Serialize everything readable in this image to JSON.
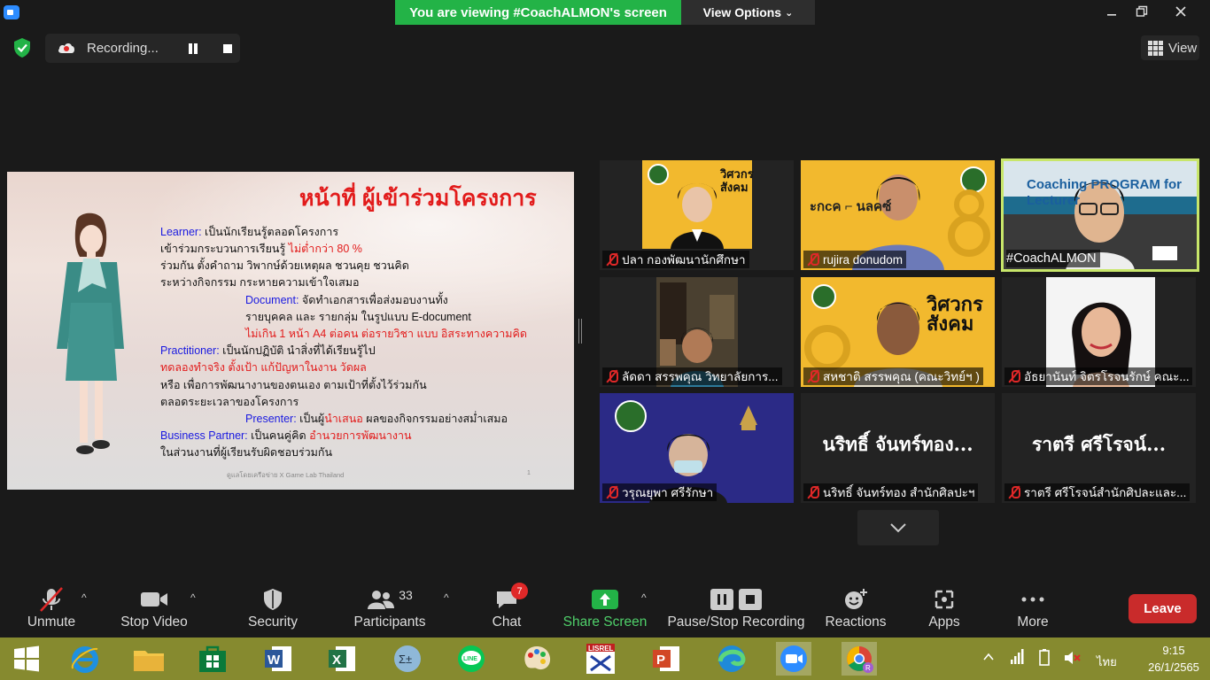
{
  "window": {
    "viewing_banner": "You are viewing #CoachALMON's screen",
    "view_options": "View Options"
  },
  "recording": {
    "label": "Recording..."
  },
  "view_button": "View",
  "slide": {
    "title": "หน้าที่ ผู้เข้าร่วมโครงการ",
    "lines": [
      {
        "pre": "Learner:",
        "text": " เป็นนักเรียนรู้ตลอดโครงการ"
      },
      {
        "text": "เข้าร่วมกระบวนการเรียนรู้ ",
        "red": "ไม่ต่ำกว่า 80 %"
      },
      {
        "text": "ร่วมกัน ตั้งคำถาม วิพากษ์ด้วยเหตุผล ชวนคุย ชวนคิด"
      },
      {
        "text": "ระหว่างกิจกรรม กระหายความเข้าใจเสมอ"
      },
      {
        "pre": "Document:",
        "text": " จัดทำเอกสารเพื่อส่งมอบงานทั้ง"
      },
      {
        "text": "รายบุคคล และ รายกลุ่ม ในรูปแบบ E-document"
      },
      {
        "red": "ไม่เกิน 1 หน้า A4 ต่อคน ต่อรายวิชา แบบ อิสระทางความคิด"
      },
      {
        "pre": "Practitioner:",
        "text": " เป็นนักปฏิบัติ นำสิ่งที่ได้เรียนรู้ไป"
      },
      {
        "red": "ทดลองทำจริง ตั้งเป้า แก้ปัญหาในงาน วัดผล"
      },
      {
        "text": "หรือ เพื่อการพัฒนางานของตนเอง ตามเป้าที่ตั้งไว้ร่วมกัน"
      },
      {
        "text": "ตลอดระยะเวลาของโครงการ"
      },
      {
        "pre": "Presenter:",
        "text": " เป็นผู้",
        "red": "นำเสนอ",
        "post": " ผลของกิจกรรมอย่างสม่ำเสมอ"
      },
      {
        "pre": "Business Partner:",
        "text": " เป็นคนคู่คิด ",
        "red": "อำนวยการพัฒนางาน"
      },
      {
        "text": "ในส่วนงานที่ผู้เรียนรับผิดชอบร่วมกัน"
      }
    ],
    "footer": "ดูแลโดยเครือข่าย X Game Lab Thailand",
    "page_number": "1"
  },
  "tiles": [
    {
      "name": "ปลา กองพัฒนานักศึกษา",
      "muted": true
    },
    {
      "name": "rujira donudom",
      "muted": true
    },
    {
      "name": "#CoachALMON",
      "muted": false,
      "overlay_text": "Coaching PROGRAM for Lecturer"
    },
    {
      "name": "ลัดดา สรรพคุณ วิทยาลัยการ...",
      "muted": true
    },
    {
      "name": "สหชาติ สรรพคุณ (คณะวิทย์ฯ )",
      "muted": true
    },
    {
      "name": "อัธยานันท์ จิตรโรจนรักษ์ คณะ...",
      "muted": true
    },
    {
      "name": "วรุณยุพา ศรีรักษา",
      "muted": true
    },
    {
      "name": "นริทธิ์ จันทร์ทอง สำนักศิลปะฯ",
      "muted": true,
      "big": "นริทธิ์ จันทร์ทอง..."
    },
    {
      "name": "ราตรี ศรีโรจน์สำนักศิปละและ...",
      "muted": true,
      "big": "ราตรี   ศรีโรจน์..."
    }
  ],
  "poster_text": {
    "line1": "วิศวกร",
    "line2": "สังคม"
  },
  "toolbar": {
    "unmute": "Unmute",
    "stop_video": "Stop Video",
    "security": "Security",
    "participants": "Participants",
    "participants_count": "33",
    "chat": "Chat",
    "chat_badge": "7",
    "share_screen": "Share Screen",
    "pause_stop_recording": "Pause/Stop Recording",
    "reactions": "Reactions",
    "apps": "Apps",
    "more": "More",
    "leave": "Leave"
  },
  "taskbar": {
    "lang": "ไทย",
    "time": "9:15",
    "date": "26/1/2565",
    "icons": [
      "windows-start",
      "internet-explorer",
      "file-explorer",
      "store",
      "word",
      "excel",
      "calculator",
      "line",
      "paint",
      "lisrel",
      "powerpoint",
      "edge",
      "zoom",
      "chrome"
    ]
  },
  "colors": {
    "banner_green": "#23b347",
    "share_green": "#23b347",
    "leave_red": "#c92b2b",
    "taskbar_olive": "#868a2f",
    "slide_title_red": "#e21b1b",
    "slide_blue": "#1a1ae0",
    "active_speaker": "#c8e66a"
  }
}
